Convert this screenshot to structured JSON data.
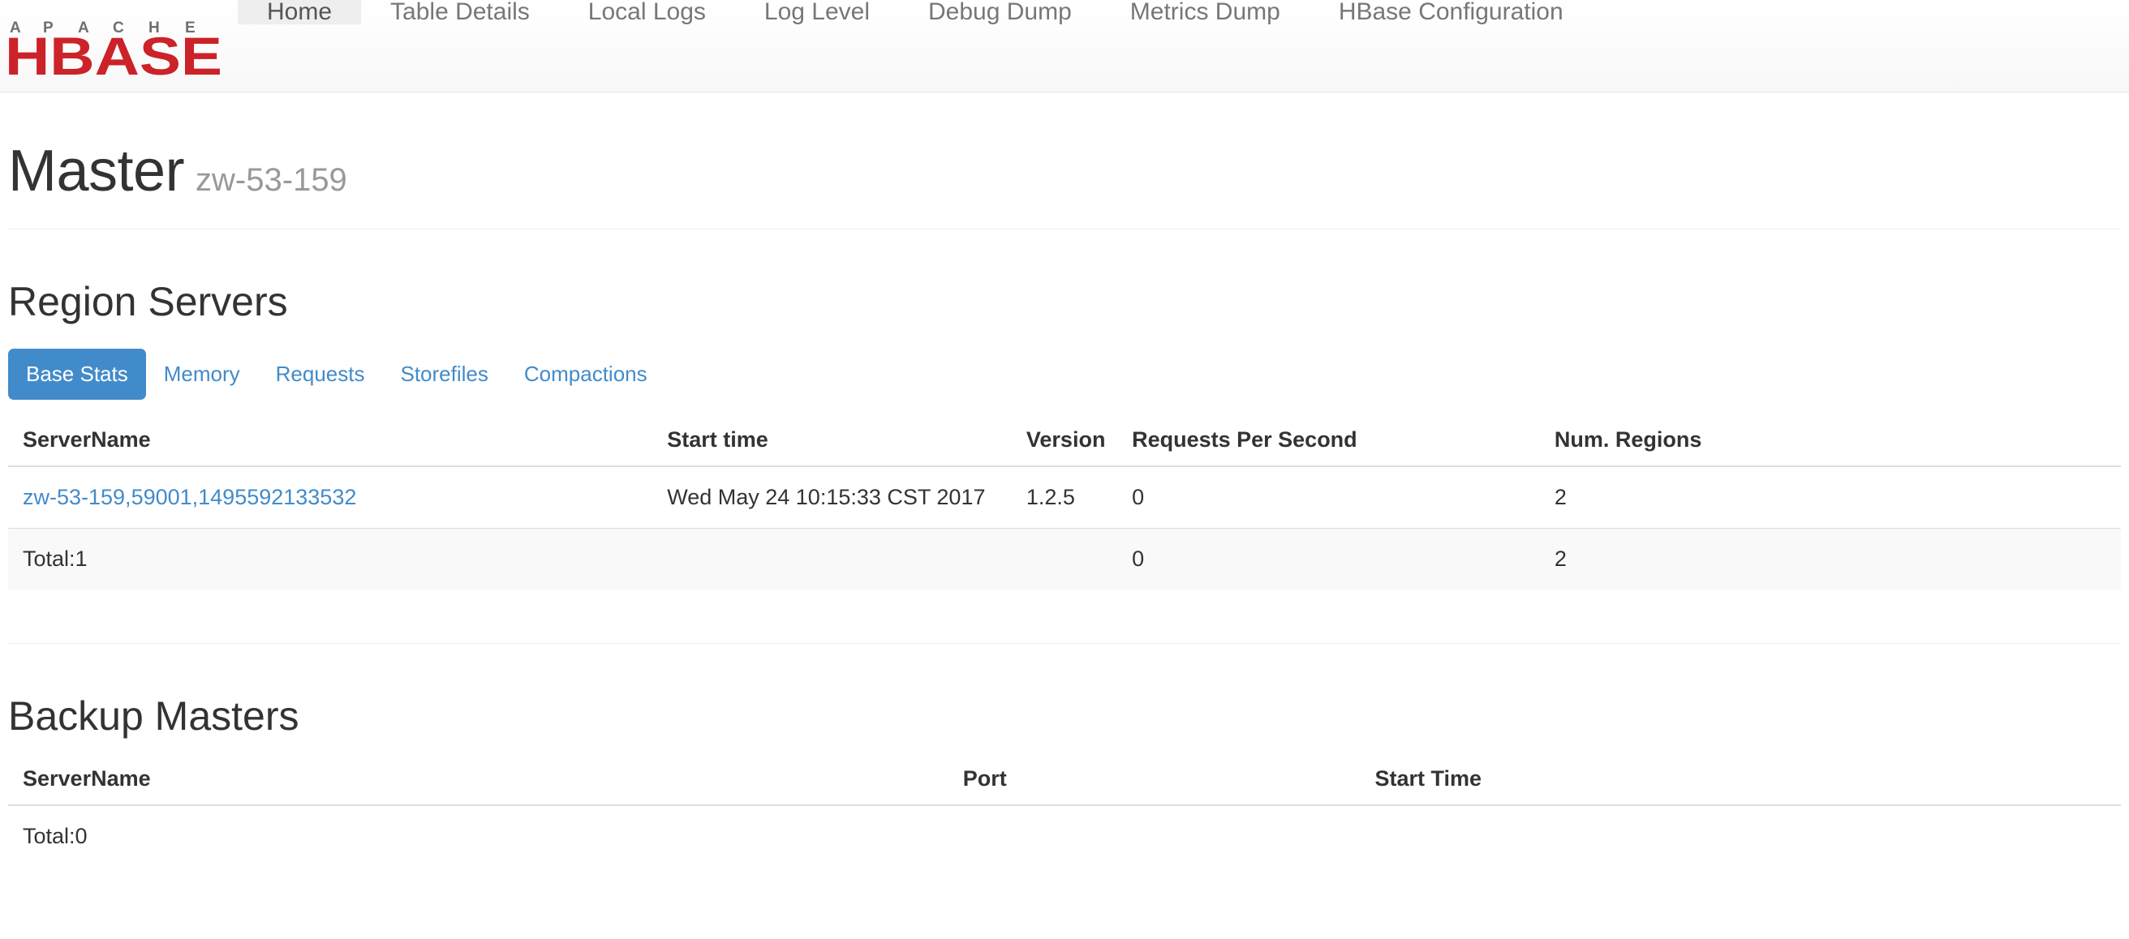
{
  "navbar": {
    "brand": {
      "top_text": "APACHE",
      "main_text": "HBASE",
      "logo_color": "#cc2229",
      "top_color": "#6d6e70"
    },
    "items": [
      {
        "label": "Home",
        "active": true
      },
      {
        "label": "Table Details",
        "active": false
      },
      {
        "label": "Local Logs",
        "active": false
      },
      {
        "label": "Log Level",
        "active": false
      },
      {
        "label": "Debug Dump",
        "active": false
      },
      {
        "label": "Metrics Dump",
        "active": false
      },
      {
        "label": "HBase Configuration",
        "active": false
      }
    ]
  },
  "header": {
    "title": "Master",
    "hostname": "zw-53-159"
  },
  "region_servers": {
    "heading": "Region Servers",
    "tabs": [
      {
        "label": "Base Stats",
        "active": true
      },
      {
        "label": "Memory",
        "active": false
      },
      {
        "label": "Requests",
        "active": false
      },
      {
        "label": "Storefiles",
        "active": false
      },
      {
        "label": "Compactions",
        "active": false
      }
    ],
    "columns": [
      "ServerName",
      "Start time",
      "Version",
      "Requests Per Second",
      "Num. Regions"
    ],
    "rows": [
      {
        "server_name": "zw-53-159,59001,1495592133532",
        "start_time": "Wed May 24 10:15:33 CST 2017",
        "version": "1.2.5",
        "requests_per_second": "0",
        "num_regions": "2"
      }
    ],
    "total_row": {
      "label": "Total:1",
      "start_time": "",
      "version": "",
      "requests_per_second": "0",
      "num_regions": "2"
    }
  },
  "backup_masters": {
    "heading": "Backup Masters",
    "columns": [
      "ServerName",
      "Port",
      "Start Time"
    ],
    "rows": [],
    "total_row": {
      "label": "Total:0",
      "port": "",
      "start_time": ""
    }
  },
  "colors": {
    "accent_blue": "#428bca",
    "brand_red": "#cc2229",
    "text_dark": "#333333",
    "text_muted": "#999999",
    "nav_text": "#777777"
  }
}
